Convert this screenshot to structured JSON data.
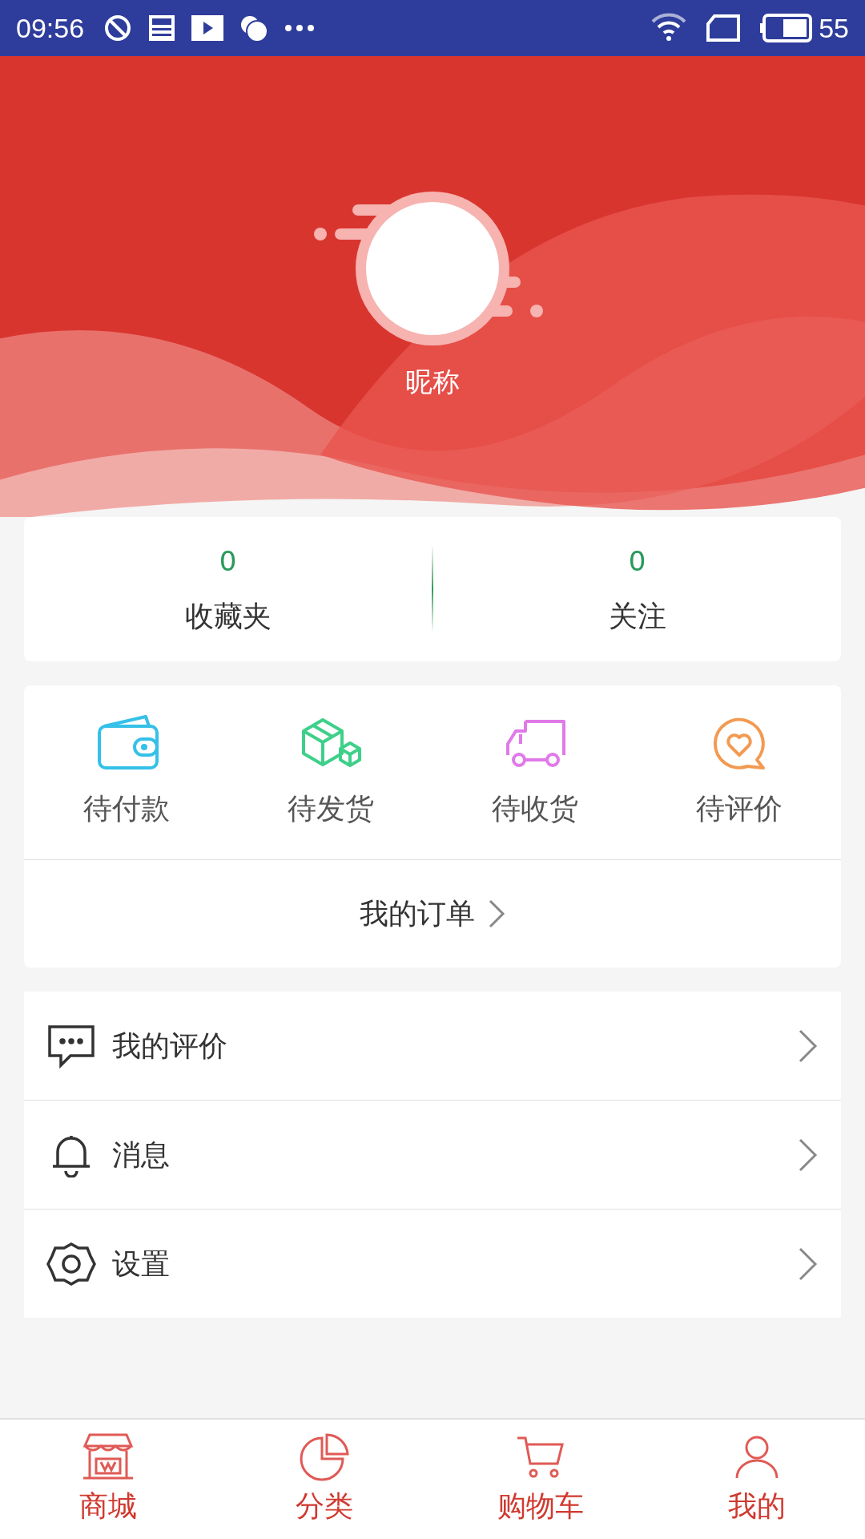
{
  "status_bar": {
    "time": "09:56",
    "battery": "55"
  },
  "profile": {
    "nickname": "昵称"
  },
  "stats": [
    {
      "count": "0",
      "label": "收藏夹"
    },
    {
      "count": "0",
      "label": "关注"
    }
  ],
  "order_statuses": [
    {
      "kind": "wallet",
      "label": "待付款"
    },
    {
      "kind": "package",
      "label": "待发货"
    },
    {
      "kind": "truck",
      "label": "待收货"
    },
    {
      "kind": "review",
      "label": "待评价"
    }
  ],
  "orders_link": "我的订单",
  "menu": [
    {
      "kind": "comment",
      "label": "我的评价"
    },
    {
      "kind": "bell",
      "label": "消息"
    },
    {
      "kind": "gear",
      "label": "设置"
    }
  ],
  "tab_bar": [
    {
      "kind": "shop",
      "label": "商城"
    },
    {
      "kind": "category",
      "label": "分类"
    },
    {
      "kind": "cart",
      "label": "购物车"
    },
    {
      "kind": "user",
      "label": "我的"
    }
  ]
}
